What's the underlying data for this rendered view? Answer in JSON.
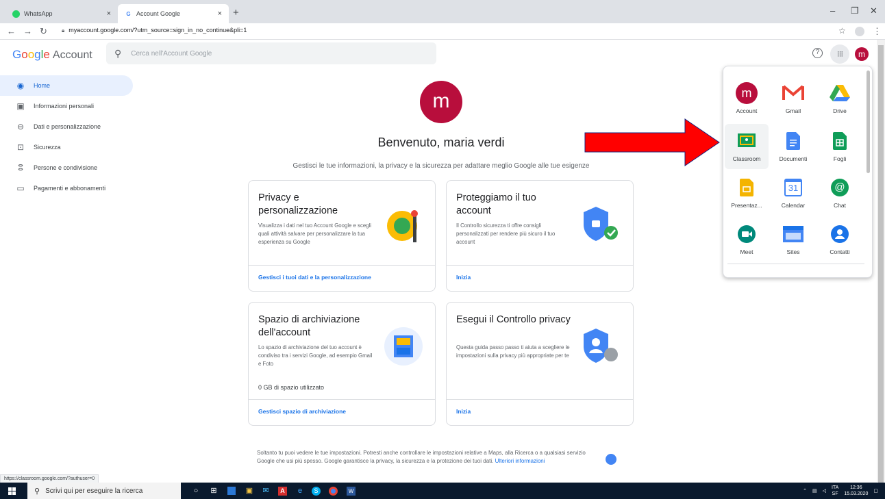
{
  "browser": {
    "tabs": [
      {
        "title": "WhatsApp",
        "icon": "whatsapp-icon"
      },
      {
        "title": "Account Google",
        "icon": "google-icon"
      }
    ],
    "url": "myaccount.google.com/?utm_source=sign_in_no_continue&pli=1",
    "status_url": "https://classroom.google.com/?authuser=0"
  },
  "header": {
    "logo_google": [
      "G",
      "o",
      "o",
      "g",
      "l",
      "e"
    ],
    "logo_account": "Account",
    "search_placeholder": "Cerca nell'Account Google",
    "avatar_letter": "m"
  },
  "sidebar": {
    "items": [
      {
        "label": "Home",
        "icon": "person-circle-icon"
      },
      {
        "label": "Informazioni personali",
        "icon": "id-card-icon"
      },
      {
        "label": "Dati e personalizzazione",
        "icon": "toggle-icon"
      },
      {
        "label": "Sicurezza",
        "icon": "lock-icon"
      },
      {
        "label": "Persone e condivisione",
        "icon": "people-icon"
      },
      {
        "label": "Pagamenti e abbonamenti",
        "icon": "credit-card-icon"
      }
    ]
  },
  "main": {
    "avatar_letter": "m",
    "title": "Benvenuto, maria verdi",
    "subtitle": "Gestisci le tue informazioni, la privacy e la sicurezza per adattare meglio Google alle tue esigenze",
    "cards": [
      {
        "title": "Privacy e personalizzazione",
        "desc": "Visualizza i dati nel tuo Account Google e scegli quali attività salvare per personalizzare la tua esperienza su Google",
        "link": "Gestisci i tuoi dati e la personalizzazione"
      },
      {
        "title": "Proteggiamo il tuo account",
        "desc": "Il Controllo sicurezza ti offre consigli personalizzati per rendere più sicuro il tuo account",
        "link": "Inizia"
      },
      {
        "title": "Spazio di archiviazione dell'account",
        "desc": "Lo spazio di archiviazione del tuo account è condiviso tra i servizi Google, ad esempio Gmail e Foto",
        "extra": "0 GB di spazio utilizzato",
        "link": "Gestisci spazio di archiviazione"
      },
      {
        "title": "Esegui il Controllo privacy",
        "desc": "Questa guida passo passo ti aiuta a scegliere le impostazioni sulla privacy più appropriate per te",
        "link": "Inizia"
      }
    ],
    "footer_text": "Soltanto tu puoi vedere le tue impostazioni. Potresti anche controllare le impostazioni relative a Maps, alla Ricerca o a qualsiasi servizio Google che usi più spesso. Google garantisce la privacy, la sicurezza e la protezione dei tuoi dati.",
    "footer_link": "Ulteriori informazioni"
  },
  "apps_menu": {
    "apps": [
      {
        "label": "Account",
        "icon": "account-icon"
      },
      {
        "label": "Gmail",
        "icon": "gmail-icon"
      },
      {
        "label": "Drive",
        "icon": "drive-icon"
      },
      {
        "label": "Classroom",
        "icon": "classroom-icon"
      },
      {
        "label": "Documenti",
        "icon": "docs-icon"
      },
      {
        "label": "Fogli",
        "icon": "sheets-icon"
      },
      {
        "label": "Presentaz...",
        "icon": "slides-icon"
      },
      {
        "label": "Calendar",
        "icon": "calendar-icon"
      },
      {
        "label": "Chat",
        "icon": "chat-icon"
      },
      {
        "label": "Meet",
        "icon": "meet-icon"
      },
      {
        "label": "Sites",
        "icon": "sites-icon"
      },
      {
        "label": "Contatti",
        "icon": "contacts-icon"
      }
    ],
    "account_letter": "m",
    "calendar_day": "31"
  },
  "taskbar": {
    "search_placeholder": "Scrivi qui per eseguire la ricerca",
    "lang": "ITA",
    "lang_sub": "SF",
    "time": "12:36",
    "date": "15.03.2020"
  },
  "colors": {
    "accent": "#1a73e8",
    "avatar": "#b80e3c",
    "arrow": "#ff0000"
  }
}
